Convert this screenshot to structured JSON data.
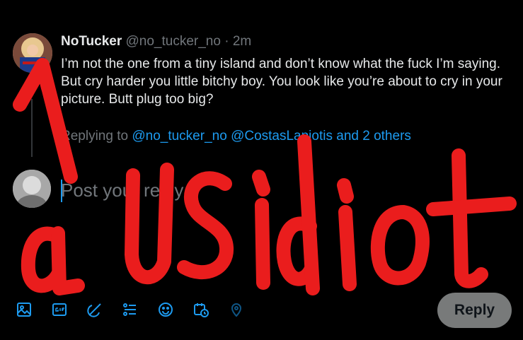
{
  "tweet": {
    "author_name": "NoTucker",
    "author_handle": "@no_tucker_no",
    "separator": "·",
    "time": "2m",
    "text": "I’m not the one from a tiny island and don’t know what the fuck I’m saying. But cry harder you little bitchy boy. You look like you’re about to cry in your picture. Butt plug too big?"
  },
  "replying": {
    "prefix": "Replying to",
    "mention_1": "@no_tucker_no",
    "mention_2": "@CostasLapiotis",
    "suffix": "and 2 others"
  },
  "composer": {
    "placeholder": "Post your reply",
    "reply_button": "Reply"
  },
  "toolbar": {
    "icons": [
      "image-icon",
      "gif-icon",
      "grok-icon",
      "poll-icon",
      "emoji-icon",
      "schedule-icon",
      "location-icon"
    ]
  },
  "overlay": {
    "text": "a US idiot",
    "color": "#ea1d1d"
  },
  "colors": {
    "accent": "#1d9bf0",
    "background": "#000000",
    "secondary_text": "#71767b"
  }
}
